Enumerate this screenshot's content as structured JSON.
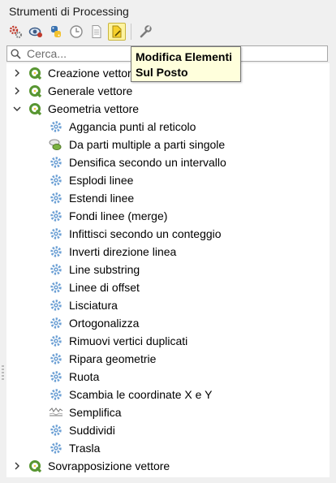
{
  "panel": {
    "title": "Strumenti di Processing"
  },
  "toolbar": {
    "buttons": [
      {
        "icon": "gears-icon"
      },
      {
        "icon": "history-icon"
      },
      {
        "icon": "python-icon"
      },
      {
        "icon": "clock-icon"
      },
      {
        "icon": "results-icon"
      },
      {
        "icon": "edit-in-place-icon"
      },
      {
        "icon": "wrench-icon"
      }
    ]
  },
  "search": {
    "placeholder": "Cerca..."
  },
  "tooltip": {
    "line1": "Modifica Elementi",
    "line2": "Sul Posto"
  },
  "tree": {
    "groups": [
      {
        "label": "Creazione vettori",
        "expanded": false
      },
      {
        "label": "Generale vettore",
        "expanded": false
      },
      {
        "label": "Geometria vettore",
        "expanded": true
      },
      {
        "label": "Sovrapposizione vettore",
        "expanded": false
      }
    ],
    "items": [
      {
        "label": "Aggancia punti al reticolo",
        "icon": "gear-icon"
      },
      {
        "label": "Da parti multiple a parti singole",
        "icon": "multipart-icon"
      },
      {
        "label": "Densifica secondo un intervallo",
        "icon": "gear-icon"
      },
      {
        "label": "Esplodi linee",
        "icon": "gear-icon"
      },
      {
        "label": "Estendi linee",
        "icon": "gear-icon"
      },
      {
        "label": "Fondi linee (merge)",
        "icon": "gear-icon"
      },
      {
        "label": "Infittisci secondo un conteggio",
        "icon": "gear-icon"
      },
      {
        "label": "Inverti direzione linea",
        "icon": "gear-icon"
      },
      {
        "label": "Line substring",
        "icon": "gear-icon"
      },
      {
        "label": "Linee di offset",
        "icon": "gear-icon"
      },
      {
        "label": "Lisciatura",
        "icon": "gear-icon"
      },
      {
        "label": "Ortogonalizza",
        "icon": "gear-icon"
      },
      {
        "label": "Rimuovi vertici duplicati",
        "icon": "gear-icon"
      },
      {
        "label": "Ripara geometrie",
        "icon": "gear-icon"
      },
      {
        "label": "Ruota",
        "icon": "gear-icon"
      },
      {
        "label": "Scambia le coordinate X e Y",
        "icon": "gear-icon"
      },
      {
        "label": "Semplifica",
        "icon": "simplify-icon"
      },
      {
        "label": "Suddividi",
        "icon": "gear-icon"
      },
      {
        "label": "Trasla",
        "icon": "gear-icon"
      }
    ]
  },
  "colors": {
    "qgis_green": "#589632",
    "gear_blue": "#6b9fd4",
    "tooltip_bg": "#ffffdc"
  }
}
